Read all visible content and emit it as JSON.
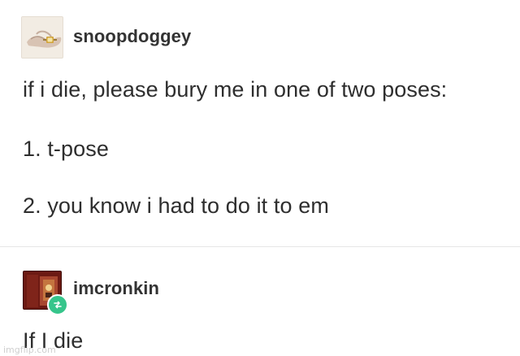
{
  "posts": [
    {
      "username": "snoopdoggey",
      "lines": [
        "if i die, please bury me in one of two poses:",
        "1. t-pose",
        "2. you know i had to do it to em"
      ]
    },
    {
      "username": "imcronkin",
      "lines": [
        "If I die"
      ],
      "badge_icon": "reblog-icon",
      "badge_color": "#36C58B"
    }
  ],
  "watermark": "imgflip.com"
}
